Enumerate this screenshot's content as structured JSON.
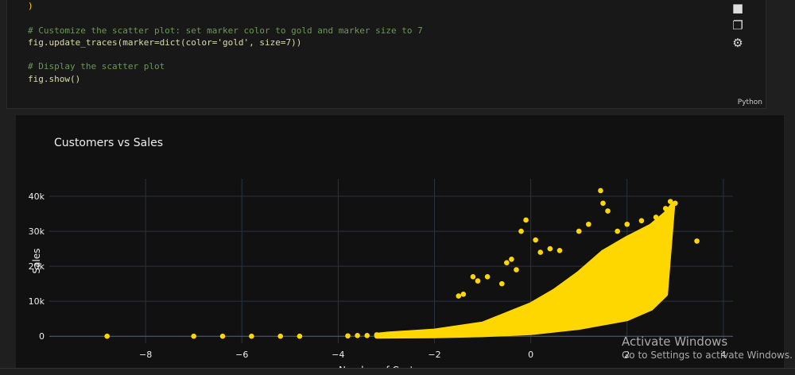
{
  "code": {
    "lines": [
      ")",
      "",
      "# Customize the scatter plot: set marker color to gold and marker size to 7",
      "fig.update_traces(marker=dict(color='gold', size=7))",
      "",
      "# Display the scatter plot",
      "fig.show()"
    ],
    "language": "Python"
  },
  "toolbar": {
    "icons": [
      "video-icon",
      "copy-icon",
      "gear-icon"
    ]
  },
  "watermark": {
    "line1": "Activate Windows",
    "line2": "Go to Settings to activate Windows."
  },
  "chart_data": {
    "type": "scatter",
    "title": "Customers vs Sales",
    "xlabel": "Number of Customers",
    "ylabel": "Sales",
    "xlim": [
      -10,
      4.2
    ],
    "ylim": [
      -2000,
      45000
    ],
    "xticks": [
      -8,
      -6,
      -4,
      -2,
      0,
      2,
      4
    ],
    "xtick_labels": [
      "−8",
      "−6",
      "−4",
      "−2",
      "0",
      "2",
      "4"
    ],
    "yticks": [
      0,
      10000,
      20000,
      30000,
      40000
    ],
    "ytick_labels": [
      "0",
      "10k",
      "20k",
      "30k",
      "40k"
    ],
    "grid": true,
    "marker_color": "#ffd700",
    "background": "#111111",
    "grid_color": "#283442",
    "dense_region": {
      "upper": [
        [
          -3.2,
          300
        ],
        [
          -3,
          600
        ],
        [
          -2,
          1500
        ],
        [
          -1,
          3500
        ],
        [
          0,
          9000
        ],
        [
          0.5,
          13000
        ],
        [
          1,
          18000
        ],
        [
          1.5,
          24000
        ],
        [
          2,
          28000
        ],
        [
          2.5,
          31500
        ],
        [
          2.8,
          35000
        ],
        [
          2.95,
          37500
        ]
      ],
      "lower": [
        [
          2.8,
          12000
        ],
        [
          2.5,
          8000
        ],
        [
          2,
          5000
        ],
        [
          1,
          2500
        ],
        [
          0,
          1000
        ],
        [
          -1,
          400
        ],
        [
          -2,
          100
        ],
        [
          -3.2,
          0
        ]
      ]
    },
    "points": [
      [
        -8.8,
        0
      ],
      [
        -7,
        0
      ],
      [
        -6.4,
        0
      ],
      [
        -5.8,
        0
      ],
      [
        -5.2,
        0
      ],
      [
        -4.8,
        0
      ],
      [
        -3.8,
        100
      ],
      [
        -3.6,
        200
      ],
      [
        -3.4,
        200
      ],
      [
        -3.2,
        400
      ],
      [
        -1.5,
        11500
      ],
      [
        -1.4,
        12000
      ],
      [
        -1.2,
        17000
      ],
      [
        -1.1,
        15800
      ],
      [
        -0.9,
        17000
      ],
      [
        -0.6,
        15000
      ],
      [
        -0.5,
        21000
      ],
      [
        -0.4,
        22000
      ],
      [
        -0.3,
        19000
      ],
      [
        -0.1,
        33200
      ],
      [
        -0.2,
        30000
      ],
      [
        0.1,
        27500
      ],
      [
        0.2,
        24000
      ],
      [
        0.4,
        25000
      ],
      [
        0.6,
        24500
      ],
      [
        1.0,
        30000
      ],
      [
        1.2,
        32000
      ],
      [
        1.45,
        41600
      ],
      [
        1.5,
        38000
      ],
      [
        1.6,
        35800
      ],
      [
        1.8,
        30000
      ],
      [
        2.0,
        32000
      ],
      [
        2.3,
        33000
      ],
      [
        2.6,
        34000
      ],
      [
        2.8,
        36500
      ],
      [
        2.9,
        38500
      ],
      [
        3.0,
        38000
      ],
      [
        3.45,
        27200
      ]
    ]
  }
}
